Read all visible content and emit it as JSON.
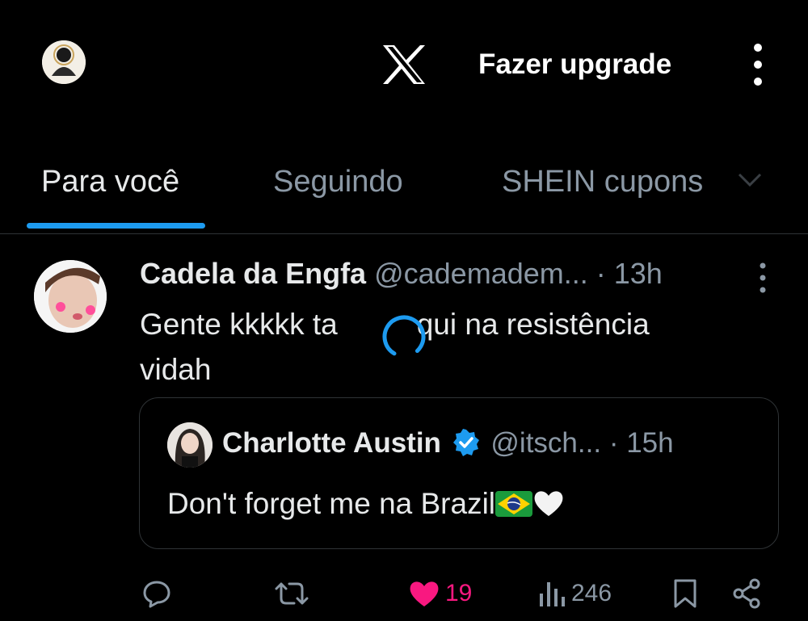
{
  "header": {
    "upgrade_label": "Fazer upgrade",
    "logo": "x-logo",
    "menu_icon": "more-vertical-icon"
  },
  "tabs": [
    {
      "label": "Para você",
      "active": true
    },
    {
      "label": "Seguindo",
      "active": false
    },
    {
      "label": "SHEIN cupons",
      "active": false
    }
  ],
  "post": {
    "author_name": "Cadela da Engfa",
    "handle": "@cademadem...",
    "time": "· 13h",
    "text_part1": "Gente kkkkk ta",
    "text_part2": "qui na resistência",
    "text_part3": "vidah",
    "quoted": {
      "author_name": "Charlotte Austin",
      "handle": "@itsch...",
      "time": "· 15h",
      "text": "Don't forget me na Brazil"
    },
    "actions": {
      "reply": "",
      "repost": "",
      "likes": "19",
      "views": "246"
    }
  },
  "colors": {
    "accent": "#1d9bf0",
    "like": "#f91880",
    "muted": "#8b98a5",
    "background": "#000000"
  }
}
